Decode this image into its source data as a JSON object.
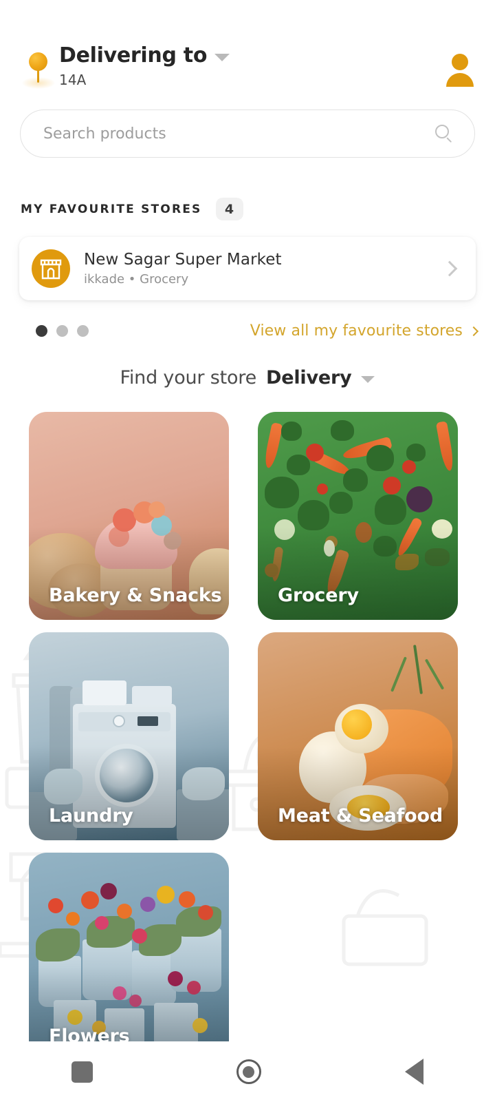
{
  "header": {
    "pin_icon": "location-pin-icon",
    "delivering_label": "Delivering to",
    "address": "14A",
    "dropdown_icon": "chevron-down-icon",
    "avatar_icon": "user-account-icon"
  },
  "search": {
    "placeholder": "Search products",
    "value": "",
    "icon": "search-icon"
  },
  "favourites": {
    "section_title": "MY FAVOURITE STORES",
    "count": "4",
    "store": {
      "icon": "storefront-icon",
      "name": "New Sagar Super Market",
      "subtitle": "ikkade • Grocery",
      "chevron_icon": "chevron-right-icon"
    },
    "carousel": {
      "total": 3,
      "active_index": 0
    },
    "view_all_label": "View all my favourite stores",
    "view_all_icon": "chevron-right-icon"
  },
  "find_store": {
    "prefix": "Find your store",
    "mode": "Delivery",
    "dropdown_icon": "chevron-down-icon"
  },
  "categories": [
    {
      "label": "Bakery & Snacks",
      "art": "bakery"
    },
    {
      "label": "Grocery",
      "art": "grocery"
    },
    {
      "label": "Laundry",
      "art": "laundry"
    },
    {
      "label": "Meat & Seafood",
      "art": "meat"
    },
    {
      "label": "Flowers",
      "art": "flowers"
    }
  ],
  "navbar": {
    "recents_icon": "square-recents-icon",
    "home_icon": "circle-home-icon",
    "back_icon": "triangle-back-icon"
  },
  "colors": {
    "accent_orange": "#e09a0e",
    "link_gold": "#d3a52c",
    "text_dark": "#262626",
    "text_muted": "#919191",
    "border": "#e2e2e2"
  }
}
